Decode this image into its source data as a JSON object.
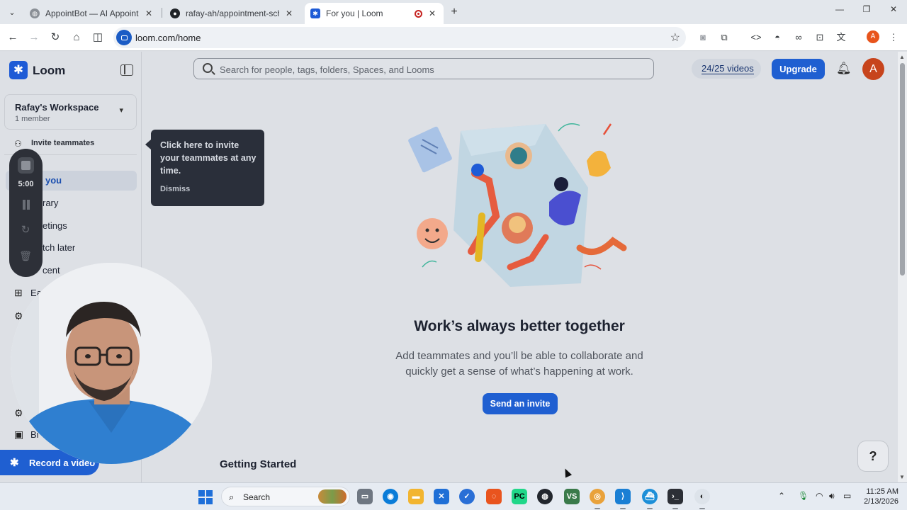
{
  "browser": {
    "tabs": [
      {
        "title": "AppointBot — AI Appointment",
        "favicon": "globe-icon",
        "active": false
      },
      {
        "title": "rafay-ah/appointment-scheduli",
        "favicon": "github-icon",
        "active": false
      },
      {
        "title": "For you | Loom",
        "favicon": "loom-icon",
        "active": true
      }
    ],
    "url": "loom.com/home",
    "profile_initial": "A"
  },
  "loom": {
    "brand": "Loom",
    "workspace_name": "Rafay's Workspace",
    "workspace_members": "1 member",
    "invite_teammates": "Invite teammates",
    "nav": {
      "for_you": "you",
      "library": "rary",
      "meetings": "etings",
      "watch_later": "tch later",
      "recent": "cent",
      "earn": "Ea",
      "billing": "Bi"
    },
    "record_button": "Record a video",
    "search_placeholder": "Search for people, tags, folders, Spaces, and Looms",
    "video_count": "24/25 videos",
    "upgrade": "Upgrade",
    "avatar_initial": "A",
    "headline": "Work’s always better together",
    "subtext": "Add teammates and you’ll be able to collaborate and quickly get a sense of what’s happening at work.",
    "send_invite": "Send an invite",
    "getting_started": "Getting Started",
    "help": "?",
    "tooltip_text": "Click here to invite your teammates at any time.",
    "tooltip_dismiss": "Dismiss",
    "recorder_time": "5:00"
  },
  "taskbar": {
    "search_label": "Search",
    "time": "11:25 AM",
    "date": "2/13/2026"
  },
  "colors": {
    "accent": "#1f5fd1",
    "avatar": "#c7441c",
    "tooltip_bg": "#2a2f3a"
  }
}
